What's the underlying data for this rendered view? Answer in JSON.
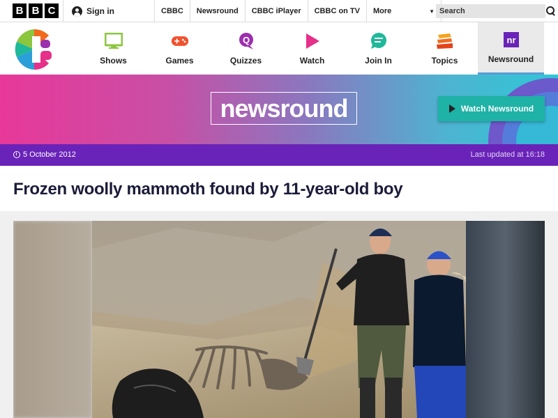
{
  "bbc_bar": {
    "logo_letters": [
      "B",
      "B",
      "C"
    ],
    "signin": "Sign in",
    "nav": [
      "CBBC",
      "Newsround",
      "CBBC iPlayer",
      "CBBC on TV"
    ],
    "more": "More",
    "search_placeholder": "Search"
  },
  "cbbc_nav": {
    "items": [
      {
        "label": "Shows",
        "icon": "tv-icon",
        "color": "#8cc63f"
      },
      {
        "label": "Games",
        "icon": "gamepad-icon",
        "color": "#f0522e"
      },
      {
        "label": "Quizzes",
        "icon": "quiz-icon",
        "color": "#9b2fae"
      },
      {
        "label": "Watch",
        "icon": "play-icon",
        "color": "#e6308a"
      },
      {
        "label": "Join In",
        "icon": "chat-icon",
        "color": "#1fb89a"
      },
      {
        "label": "Topics",
        "icon": "stack-icon",
        "color": "#f26b1d"
      },
      {
        "label": "Newsround",
        "icon": "nr-icon",
        "color": "#6a23b8"
      }
    ],
    "active": "Newsround"
  },
  "banner": {
    "logo_text": "newsround",
    "watch_button": "Watch Newsround"
  },
  "article": {
    "date": "5 October 2012",
    "last_updated": "Last updated at 16:18",
    "headline": "Frozen woolly mammoth found by 11-year-old boy"
  },
  "colors": {
    "datebar": "#6a23b8",
    "watch_button": "#1fb2a6"
  }
}
